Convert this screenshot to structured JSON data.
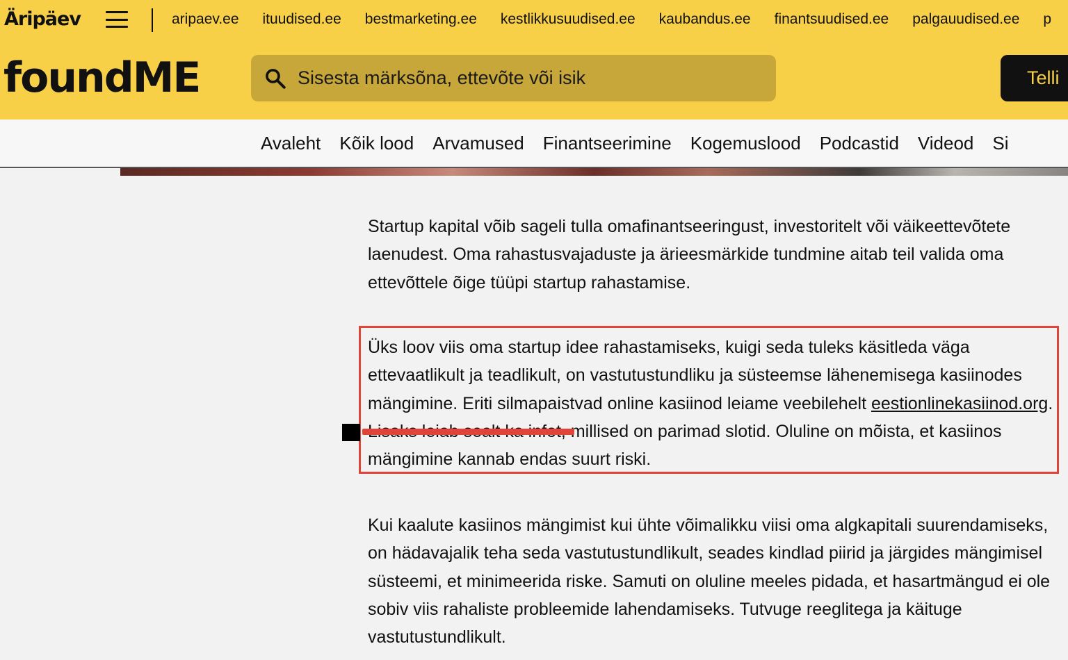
{
  "header": {
    "brand": "Äripäev",
    "sites": [
      "aripaev.ee",
      "ituudised.ee",
      "bestmarketing.ee",
      "kestlikkusuudised.ee",
      "kaubandus.ee",
      "finantsuudised.ee",
      "palgauudised.ee",
      "p"
    ],
    "logo": "foundME",
    "search_placeholder": "Sisesta märksõna, ettevõte või isik",
    "subscribe_label": "Telli"
  },
  "nav": {
    "items": [
      "Avaleht",
      "Kõik lood",
      "Arvamused",
      "Finantseerimine",
      "Kogemuslood",
      "Podcastid",
      "Videod",
      "Si"
    ]
  },
  "article": {
    "p1": "Startup kapital võib sageli tulla omafinantseeringust, investoritelt või väikeettevõtete laenudest. Oma rahastusvajaduste ja ärieesmärkide tundmine aitab teil valida oma ettevõttele õige tüüpi startup rahastamise.",
    "p2_before": "Üks loov viis oma startup idee rahastamiseks, kuigi seda tuleks käsitleda väga ettevaatlikult ja teadlikult, on vastutustundliku ja süsteemse lähenemisega kasiinodes mängimine. Eriti silmapaistvad online kasiinod leiame veebilehelt ",
    "p2_link": "eestionlinekasiinod.org",
    "p2_after": ". Lisaks leiab sealt ka infot, millised on parimad slotid. Oluline on mõista, et kasiinos mängimine kannab endas suurt riski.",
    "p3": "Kui kaalute kasiinos mängimist kui ühte võimalikku viisi oma algkapitali suurendamiseks, on hädavajalik teha seda vastutustundlikult, seades kindlad piirid ja järgides mängimisel süsteemi, et minimeerida riske. Samuti on oluline meeles pidada, et hasartmängud ei ole sobiv viis rahaliste probleemide lahendamiseks. Tutvuge reeglitega ja käituge vastutustundlikult."
  },
  "colors": {
    "header_bg": "#f8d048",
    "search_bg": "#c8a73a",
    "annotation_red": "#e04438"
  }
}
